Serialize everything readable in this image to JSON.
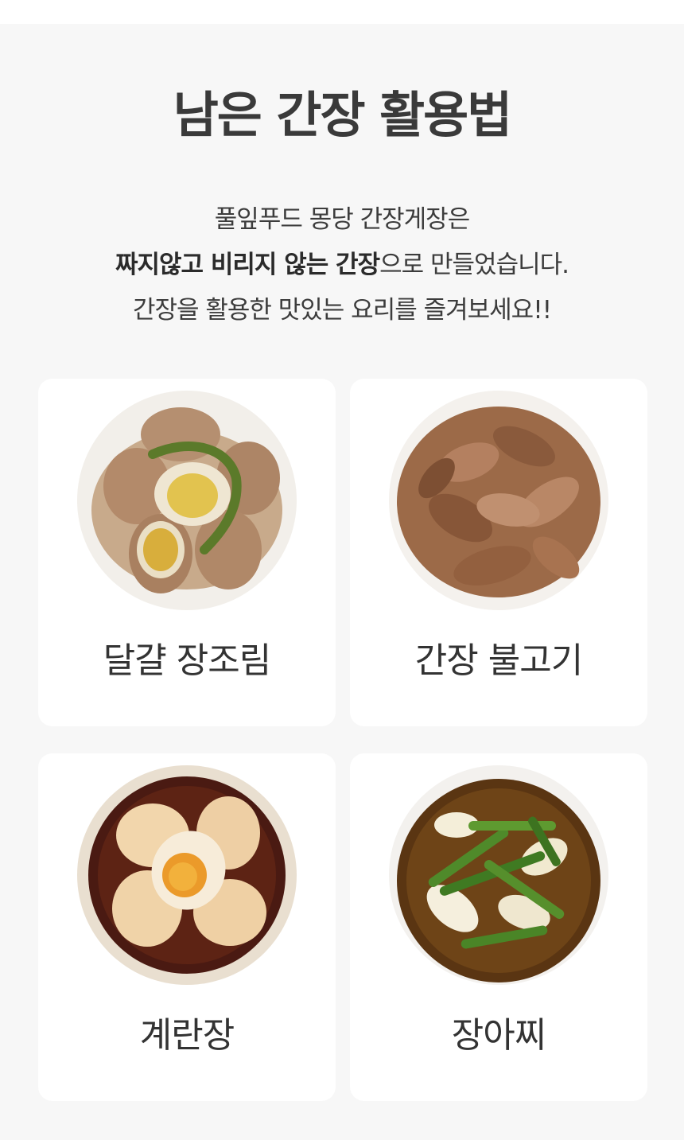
{
  "heading": "남은 간장 활용법",
  "intro": {
    "line1": "풀잎푸드 몽당 간장게장은",
    "line2_bold": "짜지않고 비리지 않는 간장",
    "line2_rest": "으로 만들었습니다.",
    "line3": "간장을 활용한 맛있는 요리를 즐겨보세요!!"
  },
  "recipes": [
    {
      "label": "달걀 장조림",
      "image": "braised-eggs-photo"
    },
    {
      "label": "간장 불고기",
      "image": "soy-bulgogi-photo"
    },
    {
      "label": "계란장",
      "image": "soy-marinated-eggs-photo"
    },
    {
      "label": "장아찌",
      "image": "pickled-vegetables-photo"
    }
  ]
}
